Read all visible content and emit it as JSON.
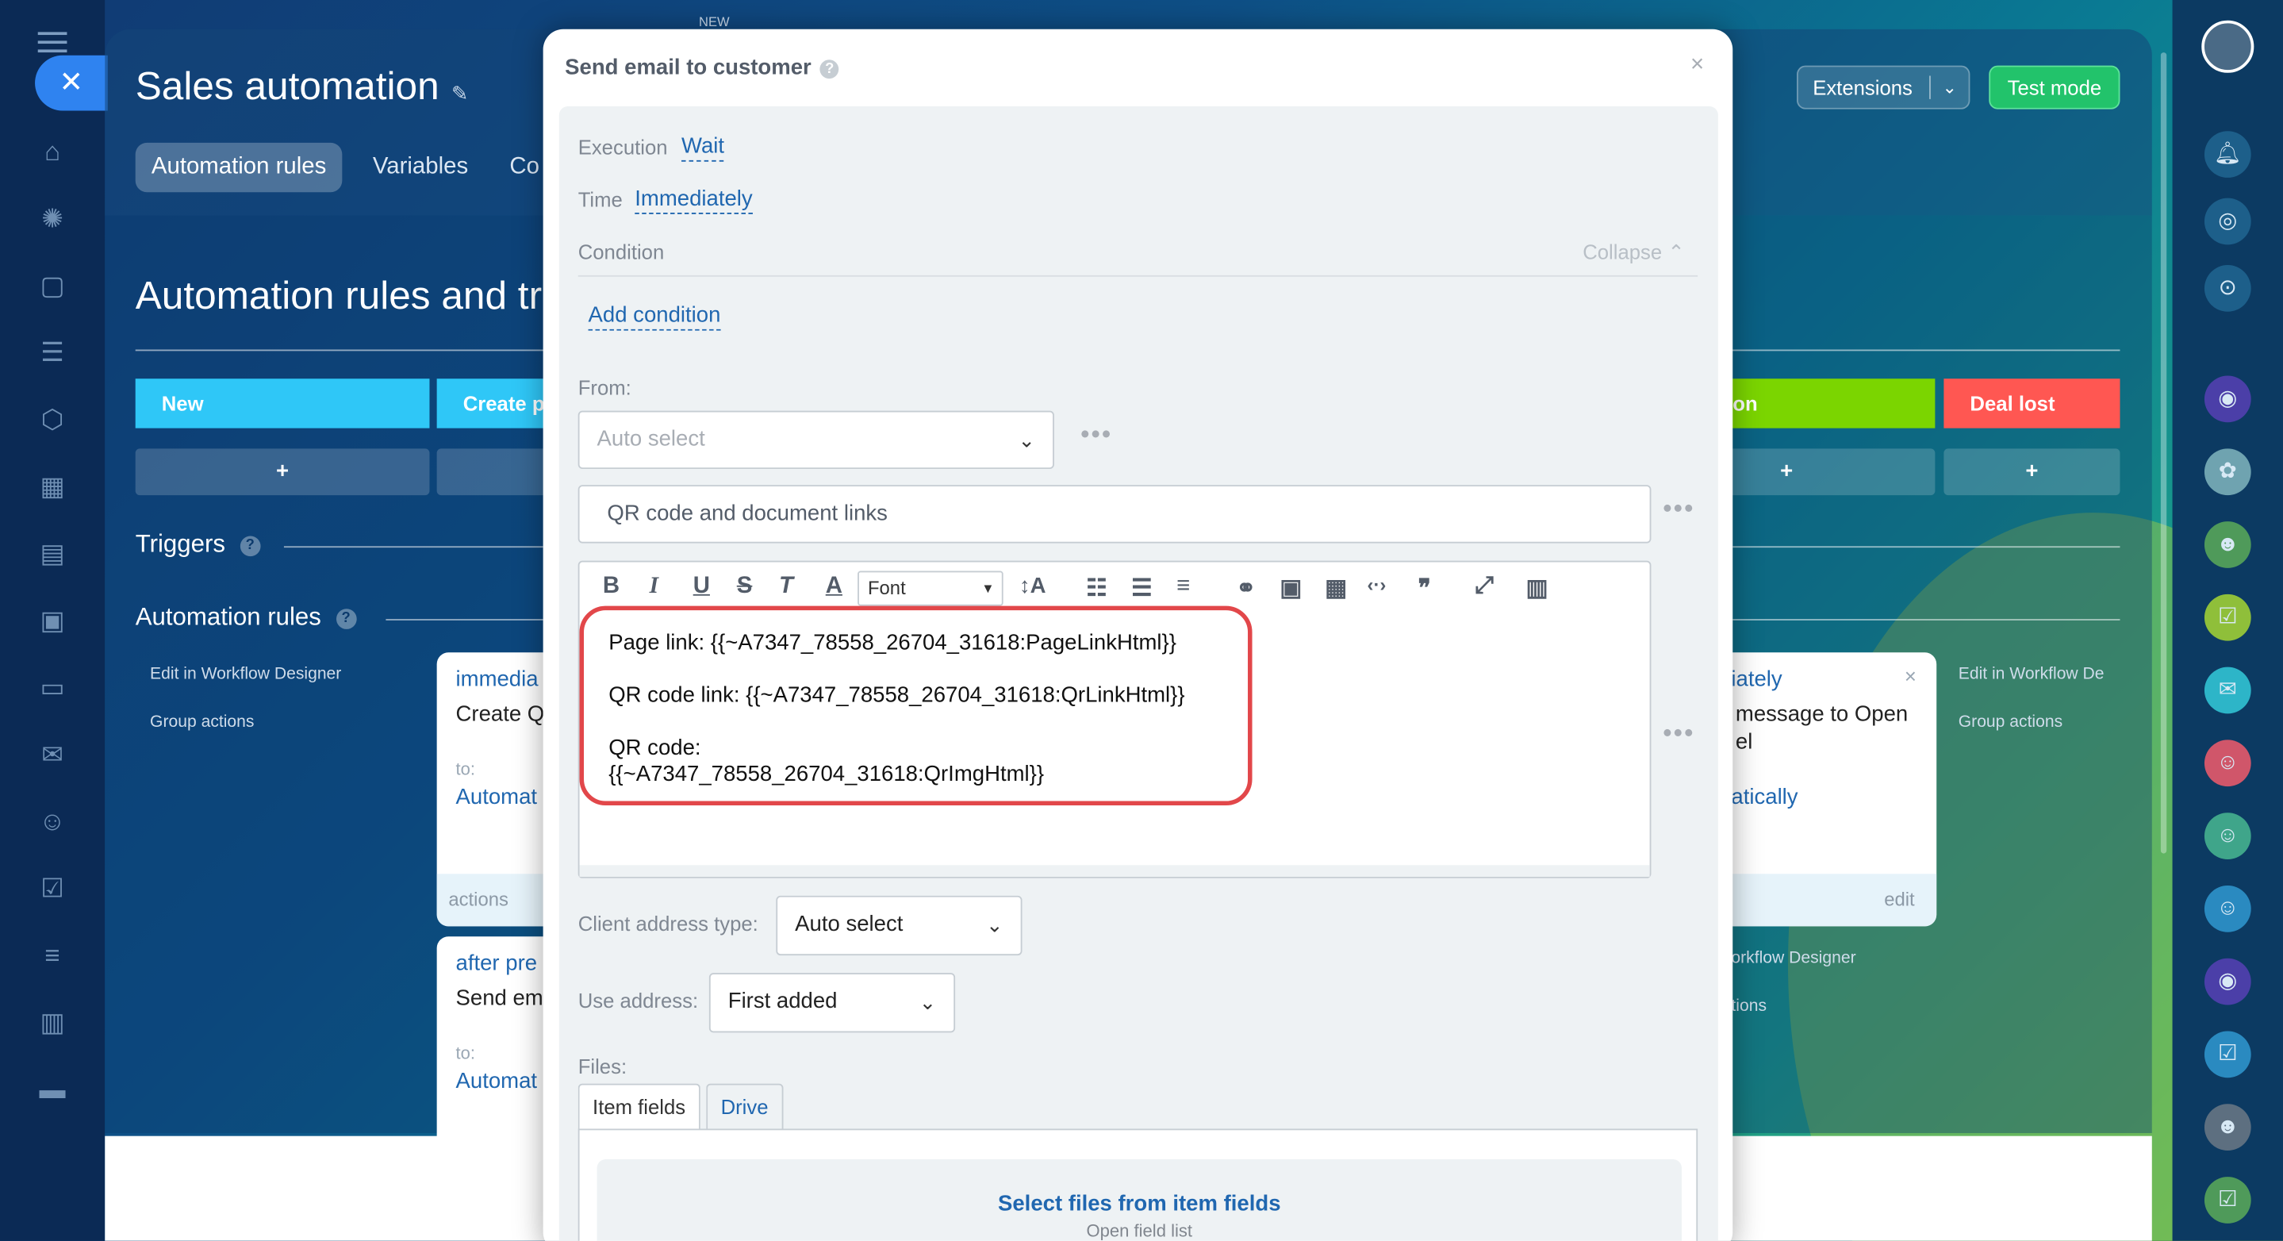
{
  "app": {
    "title": "Sales automation",
    "tabs": [
      "Automation rules",
      "Variables",
      "Co"
    ],
    "extensions_label": "Extensions",
    "test_mode_label": "Test mode",
    "new_badge": "NEW"
  },
  "page": {
    "heading": "Automation rules and tr",
    "stages": [
      {
        "label": "New",
        "color": "#2fc7f7"
      },
      {
        "label": "Create p",
        "color": "#2fc7f7"
      },
      {
        "label": "on",
        "color": "#7bd500"
      },
      {
        "label": "Deal lost",
        "color": "#ff5752"
      }
    ],
    "plus": "+",
    "triggers_label": "Triggers",
    "rules_label": "Automation rules",
    "help": "?"
  },
  "left_links": {
    "edit": "Edit in Workflow Designer",
    "group": "Group actions"
  },
  "right_links": {
    "edit": "Edit in Workflow De",
    "group": "Group actions",
    "edit2": "orkflow Designer",
    "group2": "tions"
  },
  "cards": {
    "c1_when": "immedia",
    "c1_text": "Create Q",
    "c1_to": "to:",
    "c1_link": "Automat",
    "c1_foot": "actions",
    "c2_when": "after pre",
    "c2_text": "Send em",
    "c2_to": "to:",
    "c2_link": "Automat",
    "c3_when": "iately",
    "c3_text": "message to Open",
    "c3_text2": "el",
    "c3_link": "atically",
    "c3_foot": "edit",
    "c3_close": "×"
  },
  "modal": {
    "title": "Send email to customer",
    "help": "?",
    "close": "×",
    "execution_label": "Execution",
    "execution_value": "Wait",
    "time_label": "Time",
    "time_value": "Immediately",
    "condition_label": "Condition",
    "collapse_label": "Collapse",
    "add_condition": "Add condition",
    "from_label": "From:",
    "from_placeholder": "Auto select",
    "subject_value": "QR code and document links",
    "more": "•••",
    "toolbar": {
      "bold": "B",
      "italic": "I",
      "underline": "U",
      "strike": "S",
      "clear": "T",
      "color": "A",
      "font": "Font",
      "size": "↕A"
    },
    "body_lines": [
      "Page link: {{~A7347_78558_26704_31618:PageLinkHtml}}",
      "QR code link: {{~A7347_78558_26704_31618:QrLinkHtml}}",
      "QR code:",
      "{{~A7347_78558_26704_31618:QrImgHtml}}"
    ],
    "client_address_label": "Client address type:",
    "client_address_value": "Auto select",
    "use_address_label": "Use address:",
    "use_address_value": "First added",
    "files_label": "Files:",
    "files_tabs": [
      "Item fields",
      "Drive"
    ],
    "files_action": "Select files from item fields",
    "files_sub": "Open field list"
  },
  "colors": {
    "accent": "#2067b0",
    "highlight": "#e2474a",
    "test_mode": "#22c36b"
  }
}
